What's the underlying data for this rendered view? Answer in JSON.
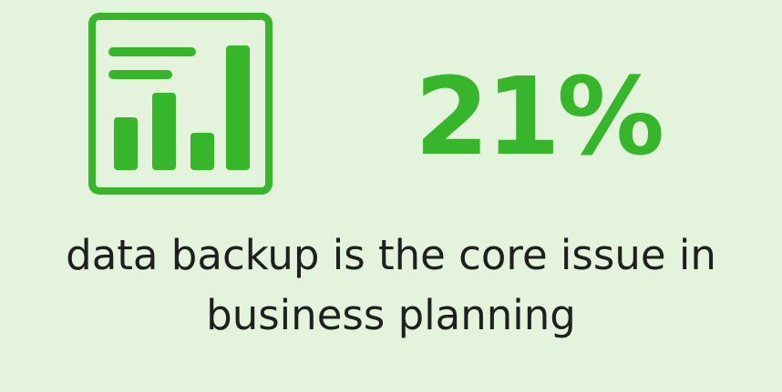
{
  "stat": {
    "value": "21%"
  },
  "caption": {
    "line1": "data backup is the core issue in",
    "line2": "business planning"
  },
  "icon": {
    "name": "bar-chart-icon"
  },
  "colors": {
    "background": "#e3f3dc",
    "accent": "#37b62c",
    "text": "#1f1f1f"
  }
}
